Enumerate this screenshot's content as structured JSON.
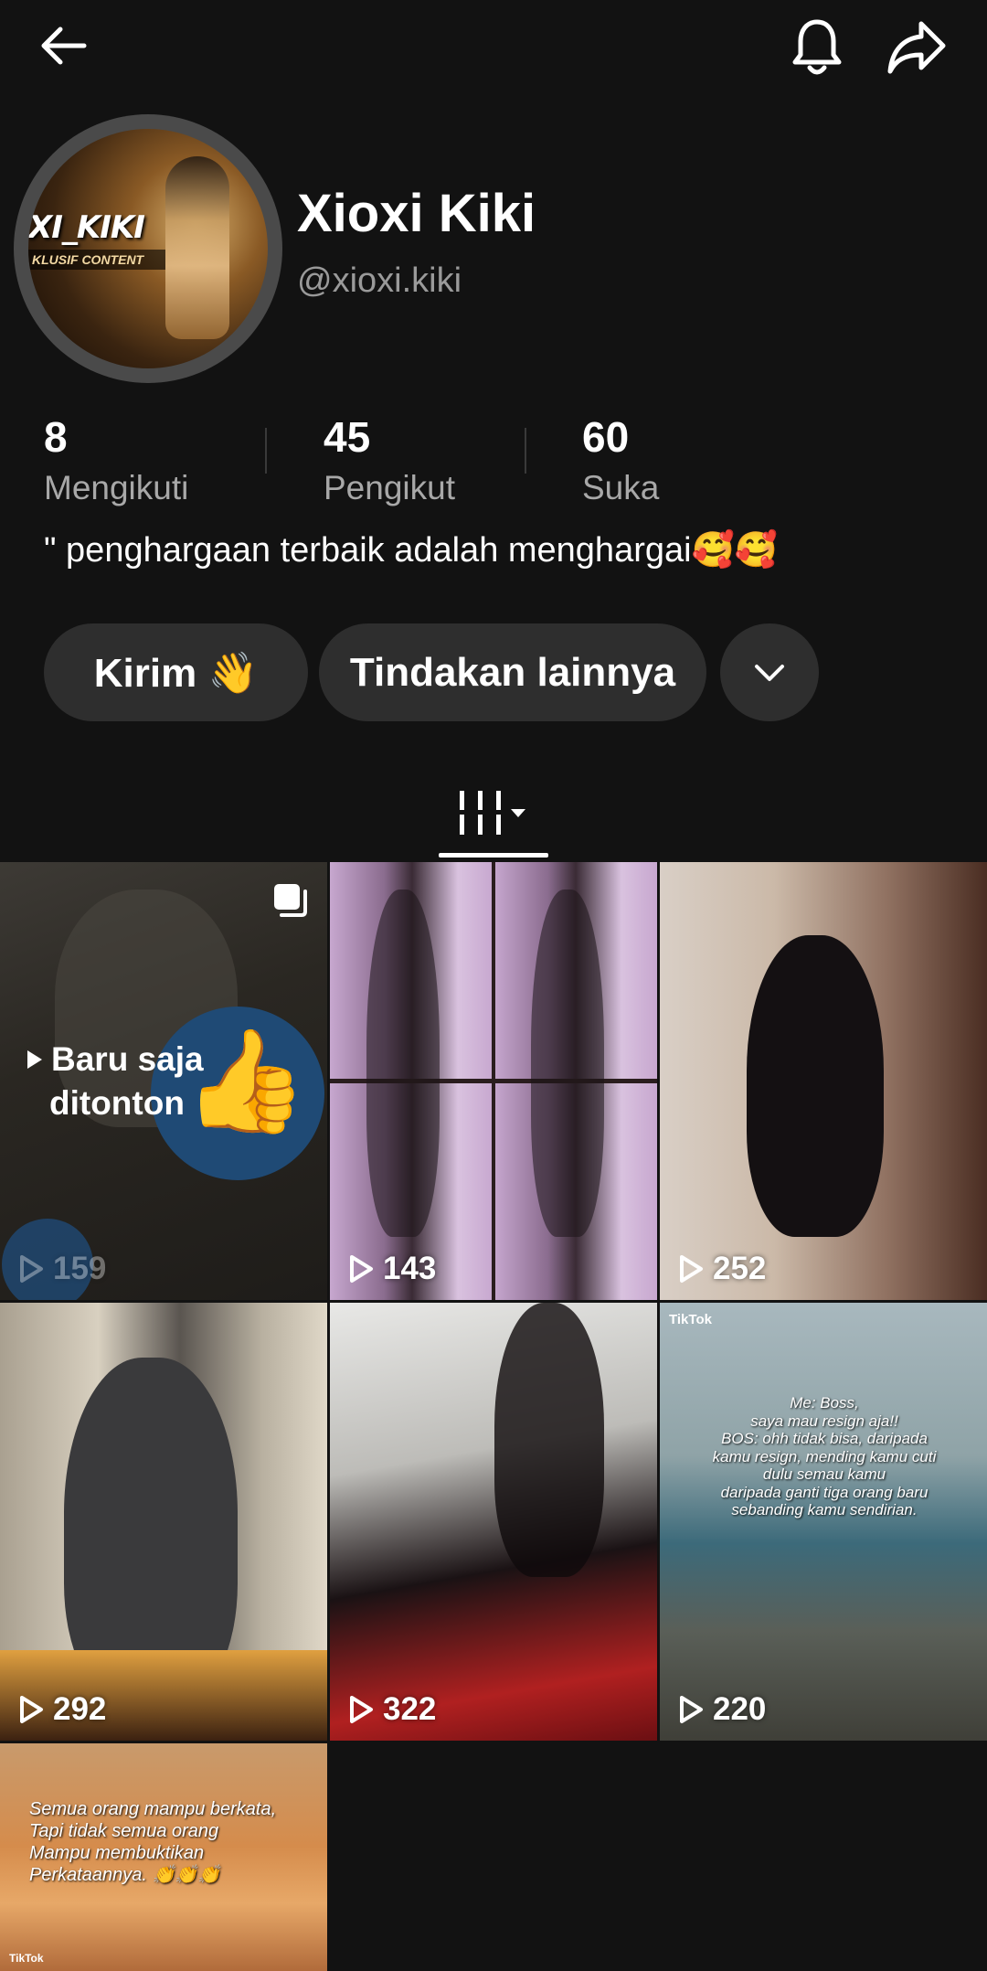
{
  "profile": {
    "display_name": "Xioxi Kiki",
    "handle": "@xioxi.kiki",
    "avatar_text": "XI_KIKI",
    "avatar_subtext": "KLUSIF CONTENT",
    "bio": "\" penghargaan terbaik adalah menghargai🥰🥰"
  },
  "stats": [
    {
      "value": "8",
      "label": "Mengikuti"
    },
    {
      "value": "45",
      "label": "Pengikut"
    },
    {
      "value": "60",
      "label": "Suka"
    }
  ],
  "actions": {
    "send_label": "Kirim 👋",
    "more_label": "Tindakan lainnya"
  },
  "icons": {
    "back": "back-arrow-icon",
    "bell": "bell-icon",
    "share": "share-icon",
    "dropdown": "chevron-down-icon",
    "grid": "video-grid-icon",
    "play": "play-icon",
    "multi": "photo-carousel-icon"
  },
  "videos": [
    {
      "views": "159",
      "recent_label_line1": "Baru saja",
      "recent_label_line2": "ditonton"
    },
    {
      "views": "143"
    },
    {
      "views": "252"
    },
    {
      "views": "292"
    },
    {
      "views": "322"
    },
    {
      "views": "220",
      "tiktok_label": "TikTok",
      "caption_lines": [
        "Me: Boss,",
        "saya mau resign aja!!",
        "BOS: ohh tidak bisa, daripada",
        "kamu resign, mending kamu cuti",
        "dulu semau kamu",
        "daripada ganti tiga orang baru",
        "sebanding kamu sendirian."
      ]
    },
    {
      "caption": "Semua orang mampu berkata,\nTapi tidak semua orang\nMampu membuktikan\nPerkataannya. 👏👏👏",
      "tiktok_label": "TikTok"
    }
  ],
  "colors": {
    "background": "#121212",
    "pill": "#2e2e2e",
    "secondary_text": "#a8a8a8"
  }
}
